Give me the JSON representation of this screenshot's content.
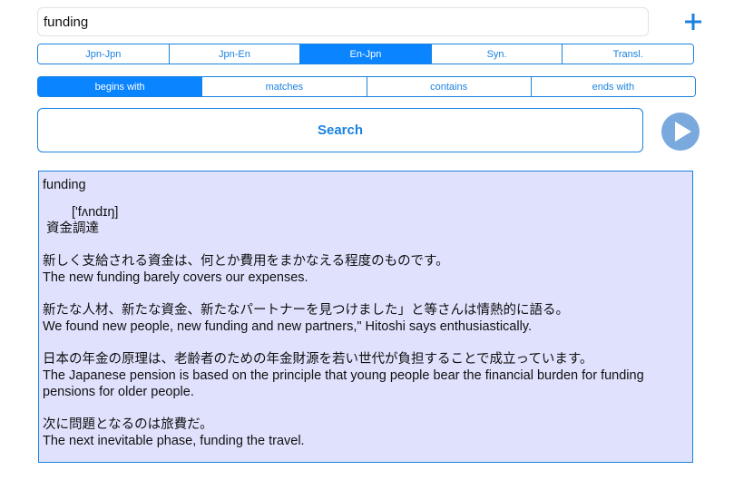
{
  "search": {
    "value": "funding",
    "add_label": "+"
  },
  "dictionary_tabs": [
    {
      "label": "Jpn-Jpn",
      "active": false
    },
    {
      "label": "Jpn-En",
      "active": false
    },
    {
      "label": "En-Jpn",
      "active": true
    },
    {
      "label": "Syn.",
      "active": false
    },
    {
      "label": "Transl.",
      "active": false
    }
  ],
  "match_tabs": [
    {
      "label": "begins with",
      "active": true
    },
    {
      "label": "matches",
      "active": false
    },
    {
      "label": "contains",
      "active": false
    },
    {
      "label": "ends with",
      "active": false
    }
  ],
  "search_button": {
    "label": "Search"
  },
  "colors": {
    "accent": "#1a82e0",
    "active_segment": "#0a84ff",
    "result_background": "#e0e1fd",
    "play_button": "#7aa9de"
  },
  "icons": {
    "add": "plus-icon",
    "play": "play-icon"
  },
  "result": {
    "headword": "funding",
    "pronunciation": "['fʌndɪŋ]",
    "meaning": "資金調達",
    "examples": [
      {
        "ja": "新しく支給される資金は、何とか費用をまかなえる程度のものです。",
        "en": "The new funding barely covers our expenses."
      },
      {
        "ja": "新たな人材、新たな資金、新たなパートナーを見つけました」と等さんは情熱的に語る。",
        "en": "We found new people, new funding and new partners,\" Hitoshi says enthusiastically."
      },
      {
        "ja": "日本の年金の原理は、老齢者のための年金財源を若い世代が負担することで成立っています。",
        "en": "The Japanese pension is based on the principle that young people bear the financial burden for funding pensions for older people."
      },
      {
        "ja": "次に問題となるのは旅費だ。",
        "en": "The next inevitable phase, funding the travel."
      }
    ]
  }
}
